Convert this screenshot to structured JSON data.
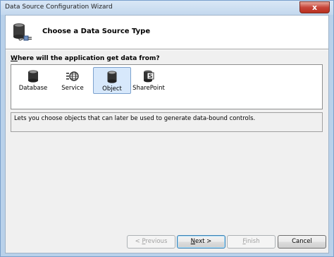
{
  "window": {
    "title": "Data Source Configuration Wizard",
    "close_glyph": "x"
  },
  "header": {
    "title": "Choose a Data Source Type"
  },
  "prompt": {
    "accel": "W",
    "rest": "here will the application get data from?"
  },
  "types": [
    {
      "label": "Database",
      "icon": "database-icon",
      "selected": false
    },
    {
      "label": "Service",
      "icon": "service-globe-icon",
      "selected": false
    },
    {
      "label": "Object",
      "icon": "object-cylinder-icon",
      "selected": true
    },
    {
      "label": "SharePoint",
      "icon": "sharepoint-icon",
      "selected": false
    }
  ],
  "description": "Lets you choose objects that can later be used to generate data-bound controls.",
  "buttons": {
    "previous": {
      "prefix": "< ",
      "accel": "P",
      "rest": "revious",
      "enabled": false
    },
    "next": {
      "prefix": "",
      "accel": "N",
      "rest": "ext >",
      "enabled": true
    },
    "finish": {
      "prefix": "",
      "accel": "F",
      "rest": "inish",
      "enabled": false
    },
    "cancel": {
      "label": "Cancel",
      "enabled": true
    }
  },
  "colors": {
    "selection_bg": "#d7e8fb",
    "selection_border": "#7da2ce",
    "close_button": "#c7463b"
  }
}
